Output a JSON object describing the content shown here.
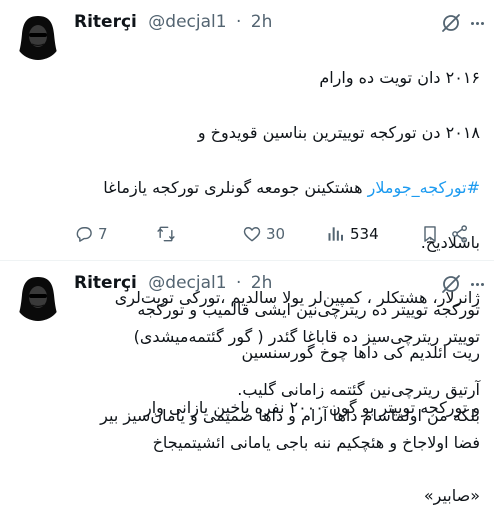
{
  "tweets": [
    {
      "author_name": "Riterçi",
      "handle": "@decjal1",
      "dot": "·",
      "time": "2h",
      "line1": "۲۰۱۶ دان تویت ده وارام",
      "line2": "۲۰۱۸ دن تورکجه توییترین بناسین قویدوخ و",
      "hashtag": "#تورکجه_جوملار",
      "line3_rest": " هشتکینن جومعه گونلری تورکجه یازماغا",
      "line4": "باشلادیخ.",
      "line5": "ژانرلار، هشتکلر ، کمپین‌لر یولا سالدیم ،تورکی تویت‌لری",
      "line6": "ریت ائلدیم کی داها چوخ گورسنسین",
      "line7": "و تورکجه توییتر بو گون ۲۰۰۰ نفره یاخین یازانی وار",
      "replies": "7",
      "retweets": "",
      "likes": "30",
      "views": "534"
    },
    {
      "author_name": "Riterçi",
      "handle": "@decjal1",
      "dot": "·",
      "time": "2h",
      "text": "تورکجه توییتر ده ریترچی‌نین ایشی قالمیب و تورکجه\nتوییتر ریترچی‌سیز ده قاباغا گئدر ( گور گئتمه‌میشدی)\n\nآرتیق ریترچی‌نین گئتمه زامانی گلیب.\n بلکه من اولماسام داها آرام و داها صمیمی و یامان‌سیز بیر\nفضا اولاجاخ و هئچکیم ننه باجی یامانی ائشیتمیجاخ\n\n«صابیر»"
    }
  ],
  "colors": {
    "accent": "#1d9bf0",
    "secondary_text": "#536471",
    "divider": "#eff3f4"
  },
  "icons": [
    "grok-icon",
    "more-icon",
    "reply-icon",
    "retweet-icon",
    "like-icon",
    "views-icon",
    "bookmark-icon",
    "share-icon"
  ]
}
